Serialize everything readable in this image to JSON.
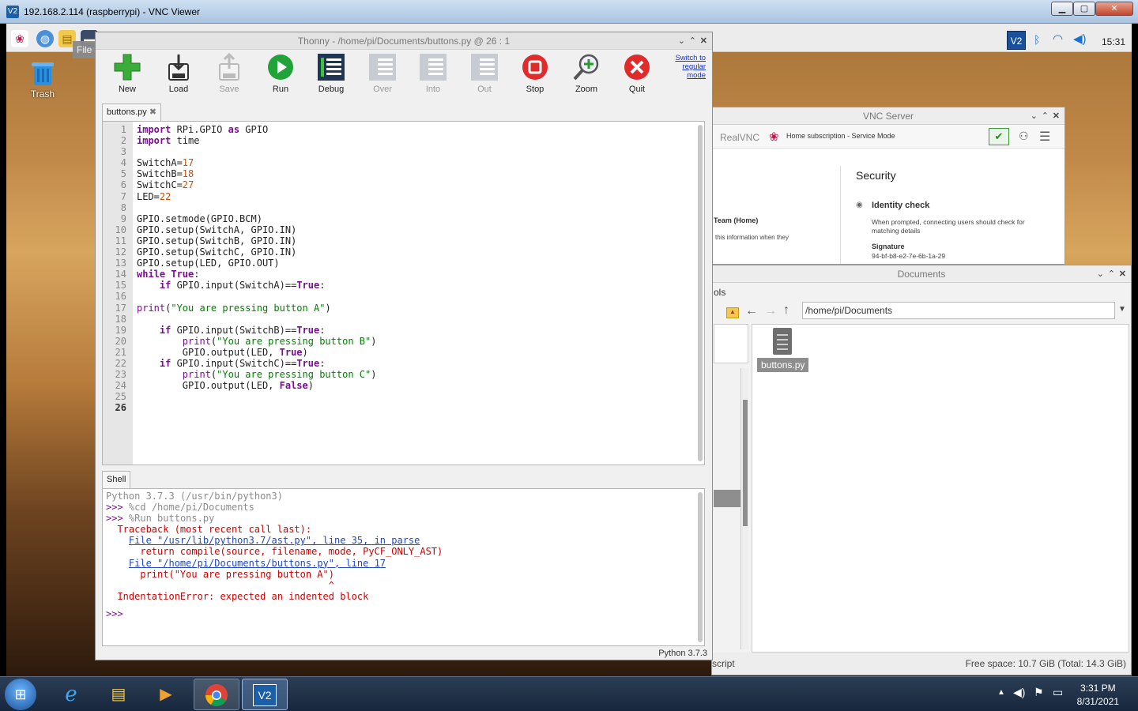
{
  "vnc_viewer": {
    "title": "192.168.2.114 (raspberrypi) - VNC Viewer",
    "icon": "vnc-viewer-icon",
    "controls": [
      "minimize-button",
      "maximize-button",
      "close-button"
    ]
  },
  "pi_panel": {
    "tooltip": "File Manager",
    "clock": "15:31"
  },
  "desktop": {
    "trash_label": "Trash"
  },
  "thonny": {
    "title": "Thonny  -  /home/pi/Documents/buttons.py  @  26 : 1",
    "toolbar": {
      "new": "New",
      "load": "Load",
      "save": "Save",
      "run": "Run",
      "debug": "Debug",
      "over": "Over",
      "into": "Into",
      "out": "Out",
      "stop": "Stop",
      "zoom": "Zoom",
      "quit": "Quit"
    },
    "mode_link": [
      "Switch to",
      "regular",
      "mode"
    ],
    "editor_tab": "buttons.py",
    "shell_tab": "Shell",
    "status": "Python 3.7.3"
  },
  "vnc_server": {
    "title": "VNC Server",
    "brand": "RealVNC",
    "subscription": "Home subscription - Service Mode",
    "team": "Team (Home)",
    "team_note": "this information when they",
    "security_heading": "Security",
    "identity_heading": "Identity check",
    "identity_text": "When prompted, connecting users should check for matching details",
    "signature_label": "Signature",
    "signature_value": "94-bf-b8-e2-7e-6b-1a-29"
  },
  "file_manager": {
    "title": "Documents",
    "path": "/home/pi/Documents",
    "side_partial": "ols",
    "file_name": "buttons.py",
    "free_space": "Free space: 10.7 GiB (Total: 14.3 GiB)",
    "left_status": "script"
  },
  "taskbar": {
    "time": "3:31 PM",
    "date": "8/31/2021"
  }
}
